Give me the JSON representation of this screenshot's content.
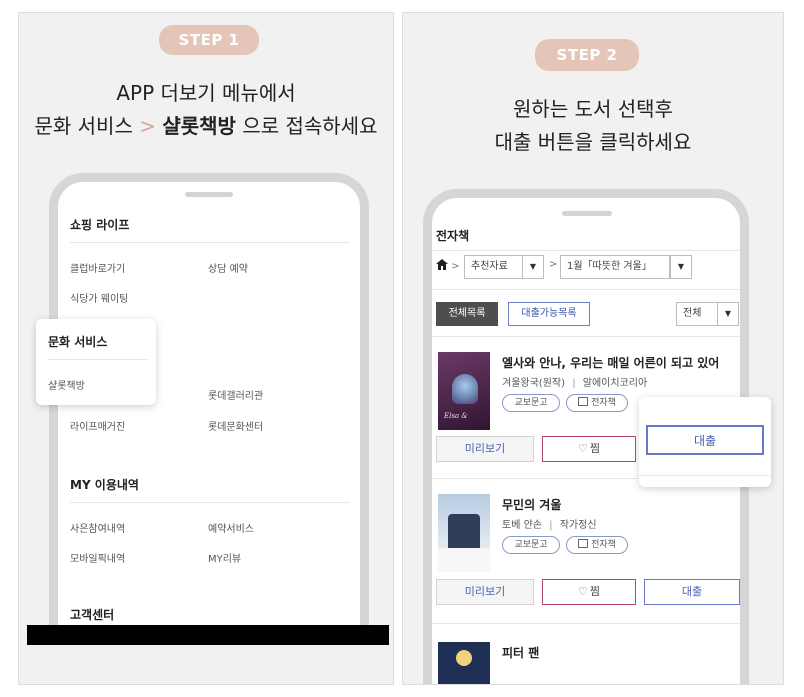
{
  "step1": {
    "badge": "STEP 1",
    "line1": "APP 더보기 메뉴에서",
    "line2_pre": "문화 서비스",
    "line2_arrow": ">",
    "line2_bold": "샬롯책방",
    "line2_post": "으로 접속하세요",
    "menu": {
      "shopping_title": "쇼핑 라이프",
      "shopping_items": [
        "클럽바로가기",
        "상담 예약",
        "식당가 웨이팅"
      ],
      "culture_title": "문화 서비스",
      "culture_items": [
        "샬롯책방",
        "롯데갤러리관",
        "라이프매거진",
        "롯데문화센터"
      ],
      "my_title": "MY 이용내역",
      "my_items": [
        "사은참여내역",
        "예약서비스",
        "모바일픽내역",
        "MY리뷰"
      ],
      "cs_title": "고객센터"
    }
  },
  "step2": {
    "badge": "STEP 2",
    "line1": "원하는 도서 선택후",
    "line2": "대출 버튼을 클릭하세요",
    "section_title": "전자책",
    "filter_category": "추천자료",
    "filter_collection": "1월「따뜻한 겨울」",
    "tab_all": "전체목록",
    "tab_available": "대출가능목록",
    "sort_value": "전체",
    "books": [
      {
        "title": "엘사와 안나, 우리는 매일 어른이 되고 있어",
        "author": "겨울왕국(원작)",
        "publisher": "알에이치코리아",
        "badge_store": "교보문고",
        "badge_type": "전자책"
      },
      {
        "title": "무민의 겨울",
        "author": "토베 얀손",
        "publisher": "작가정신",
        "badge_store": "교보문고",
        "badge_type": "전자책"
      },
      {
        "title": "피터 팬"
      }
    ],
    "btn_preview": "미리보기",
    "btn_zzim": "찜",
    "btn_loan": "대출",
    "separator": "|"
  }
}
